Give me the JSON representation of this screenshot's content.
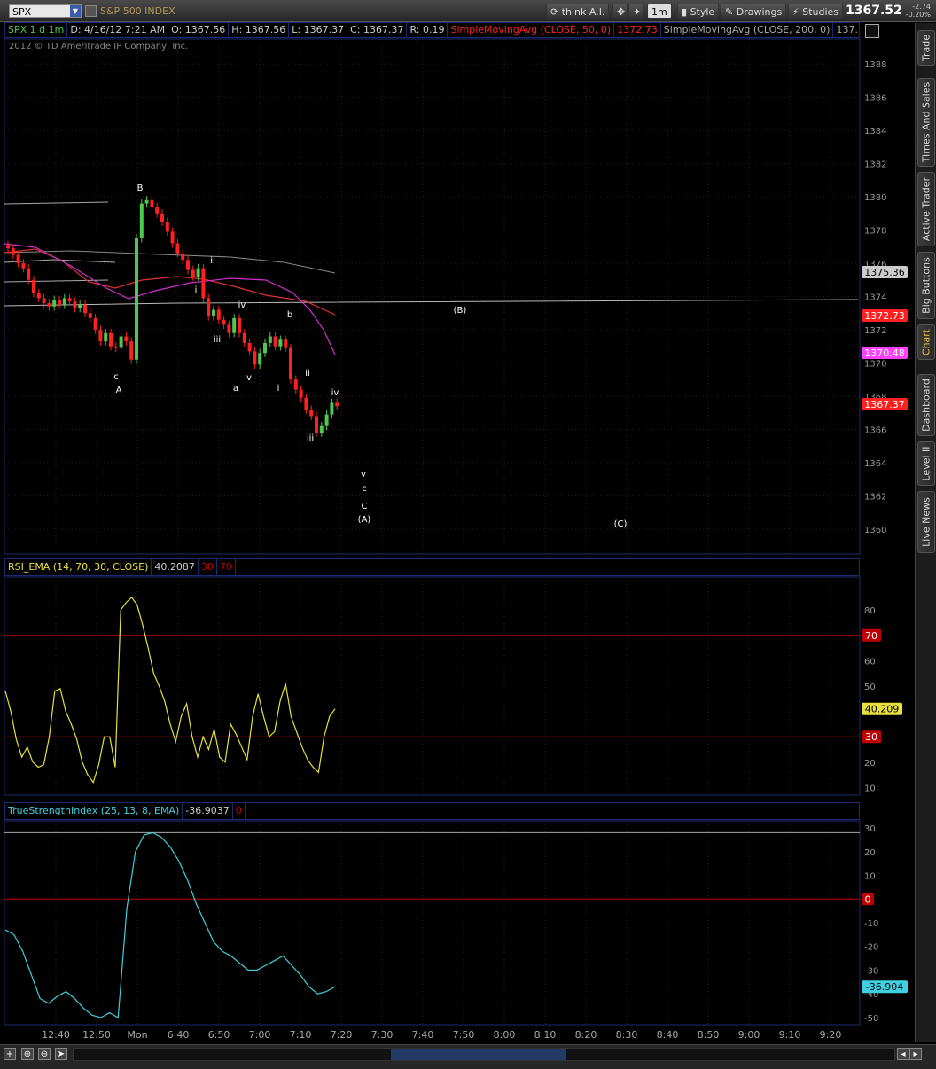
{
  "toolbar": {
    "symbol": "SPX",
    "symbol_name": "S&P 500 INDEX",
    "think_label": "think A.I.",
    "interval": "1m",
    "style_label": "Style",
    "drawings_label": "Drawings",
    "studies_label": "Studies",
    "last_price": "1367.52",
    "change": "-2.74",
    "change_pct": "-0.20%"
  },
  "sidebar": {
    "tabs": [
      "Trade",
      "Times And Sales",
      "Active Trader",
      "Big Buttons",
      "Chart",
      "Dashboard",
      "Level II",
      "Live News"
    ]
  },
  "info": {
    "symbol_tf": "SPX 1 d 1m",
    "date": "D: 4/16/12 7:21 AM",
    "open": "O: 1367.56",
    "high": "H: 1367.56",
    "low": "L: 1367.37",
    "close": "C: 1367.37",
    "range": "R: 0.19",
    "sma50": "SimpleMovingAvg (CLOSE, 50, 0)",
    "sma50_val": "1372.73",
    "sma200": "SimpleMovingAvg (CLOSE, 200, 0)",
    "sma200_val": "137..."
  },
  "copyright": "2012 © TD Ameritrade IP Company, Inc.",
  "rsi": {
    "label": "RSI_EMA (14, 70, 30, CLOSE)",
    "value": "40.2087",
    "os": "30",
    "ob": "70"
  },
  "tsi": {
    "label": "TrueStrengthIndex (25, 13, 8, EMA)",
    "value": "-36.9037",
    "zero": "0"
  },
  "colors": {
    "up": "#4fc84f",
    "down": "#ff2020",
    "sma50": "#e03030",
    "sma200": "#888888",
    "ma_magenta": "#d030d0",
    "rsi": "#e8e040",
    "tsi": "#40d0e0",
    "level": "#c00000",
    "panel_border": "#1d2c6e"
  },
  "chart_data": [
    {
      "type": "candlestick",
      "title": "SPX 1 d 1m",
      "ylim": [
        1358.5,
        1389.5
      ],
      "yticks": [
        1388,
        1386,
        1384,
        1382,
        1380,
        1378,
        1376,
        1374,
        1372,
        1370,
        1368,
        1366,
        1364,
        1362,
        1360
      ],
      "xticks": [
        "12:40",
        "12:50",
        "Mon",
        "6:40",
        "6:50",
        "7:00",
        "7:10",
        "7:20",
        "7:30",
        "7:40",
        "7:50",
        "8:00",
        "8:10",
        "8:20",
        "8:30",
        "8:40",
        "8:50",
        "9:00",
        "9:10",
        "9:20"
      ],
      "closes": [
        1376.9,
        1376.5,
        1376.0,
        1375.7,
        1375.0,
        1374.2,
        1373.9,
        1373.6,
        1373.4,
        1373.8,
        1373.5,
        1373.9,
        1373.7,
        1373.3,
        1373.5,
        1373.0,
        1372.7,
        1372.0,
        1371.3,
        1371.8,
        1371.0,
        1370.9,
        1371.6,
        1371.3,
        1370.2,
        1377.5,
        1379.6,
        1379.8,
        1379.4,
        1379.0,
        1378.5,
        1377.9,
        1377.2,
        1376.6,
        1376.2,
        1375.6,
        1375.2,
        1375.7,
        1373.9,
        1372.8,
        1373.2,
        1372.6,
        1372.3,
        1371.8,
        1372.7,
        1371.8,
        1371.2,
        1370.7,
        1369.9,
        1370.6,
        1371.2,
        1371.6,
        1371.0,
        1371.4,
        1370.9,
        1369.0,
        1368.4,
        1367.9,
        1367.2,
        1366.8,
        1365.8,
        1366.2,
        1366.9,
        1367.6,
        1367.4
      ],
      "price_labels": [
        {
          "value": "1375.36",
          "color": "#cccccc"
        },
        {
          "value": "1372.73",
          "color": "#ff2020"
        },
        {
          "value": "1370.48",
          "color": "#ff40ff"
        },
        {
          "value": "1367.37",
          "color": "#ff2020"
        }
      ],
      "annotations": [
        "B",
        "c",
        "A",
        "ii",
        "i",
        "iv",
        "iii",
        "a",
        "v",
        "b",
        "i",
        "ii",
        "iv",
        "iii",
        "v",
        "c",
        "C",
        "(A)",
        "(B)",
        "(C)"
      ]
    },
    {
      "type": "line",
      "title": "RSI_EMA (14, 70, 30, CLOSE)",
      "ylim": [
        7,
        93
      ],
      "yticks": [
        80,
        60,
        50,
        40,
        20,
        10
      ],
      "levels": [
        {
          "value": 70,
          "label": "70"
        },
        {
          "value": 30,
          "label": "30"
        }
      ],
      "current_label": "40.209",
      "values": [
        48,
        40,
        29,
        22,
        26,
        20,
        18,
        19,
        30,
        48,
        49,
        40,
        35,
        29,
        20,
        15,
        12,
        19,
        30,
        30,
        18,
        80,
        83,
        85,
        82,
        74,
        65,
        55,
        50,
        44,
        35,
        28,
        38,
        43,
        30,
        22,
        30,
        25,
        33,
        22,
        20,
        35,
        31,
        26,
        21,
        38,
        47,
        38,
        30,
        32,
        44,
        51,
        38,
        32,
        26,
        21,
        18,
        16,
        30,
        38,
        41
      ]
    },
    {
      "type": "line",
      "title": "TrueStrengthIndex (25, 13, 8, EMA)",
      "ylim": [
        -53,
        33
      ],
      "yticks": [
        30,
        20,
        10,
        -10,
        -20,
        -30,
        -40,
        -50
      ],
      "levels": [
        {
          "value": 0,
          "label": "0"
        },
        {
          "value": 28,
          "label": ""
        }
      ],
      "current_label": "-36.904",
      "values": [
        -13,
        -15,
        -22,
        -32,
        -42,
        -44,
        -41,
        -39,
        -42,
        -46,
        -49,
        -50,
        -48,
        -50,
        -4,
        20,
        27,
        28,
        26,
        22,
        16,
        8,
        -2,
        -10,
        -18,
        -22,
        -24,
        -27,
        -30,
        -30,
        -28,
        -26,
        -24,
        -28,
        -32,
        -37,
        -40,
        -39,
        -37
      ]
    }
  ]
}
